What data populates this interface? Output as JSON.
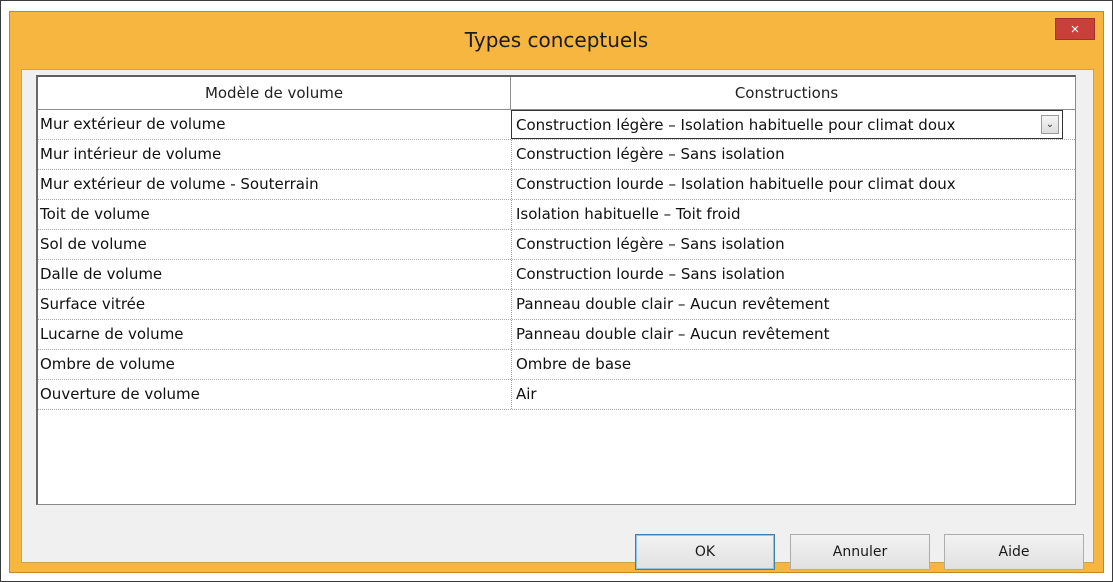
{
  "window": {
    "title": "Types conceptuels",
    "close_label": "×"
  },
  "table": {
    "columns": [
      "Modèle de volume",
      "Constructions"
    ],
    "rows": [
      {
        "model": "Mur extérieur de volume",
        "construction": "Construction légère – Isolation habituelle pour climat doux"
      },
      {
        "model": "Mur intérieur de volume",
        "construction": "Construction légère – Sans isolation"
      },
      {
        "model": "Mur extérieur de volume - Souterrain",
        "construction": "Construction lourde – Isolation habituelle pour climat doux"
      },
      {
        "model": "Toit de volume",
        "construction": "Isolation habituelle – Toit froid"
      },
      {
        "model": "Sol de volume",
        "construction": "Construction légère – Sans isolation"
      },
      {
        "model": "Dalle de volume",
        "construction": "Construction lourde – Sans isolation"
      },
      {
        "model": "Surface vitrée",
        "construction": "Panneau double clair – Aucun revêtement"
      },
      {
        "model": "Lucarne de volume",
        "construction": "Panneau double clair – Aucun revêtement"
      },
      {
        "model": "Ombre de volume",
        "construction": "Ombre de base"
      },
      {
        "model": "Ouverture de volume",
        "construction": "Air"
      }
    ],
    "dropdown_arrow": "⌄"
  },
  "buttons": {
    "ok": "OK",
    "cancel": "Annuler",
    "help": "Aide"
  },
  "colors": {
    "window_frame": "#f6b640",
    "close_button": "#c7403a",
    "dialog_body": "#f0f0f0"
  }
}
